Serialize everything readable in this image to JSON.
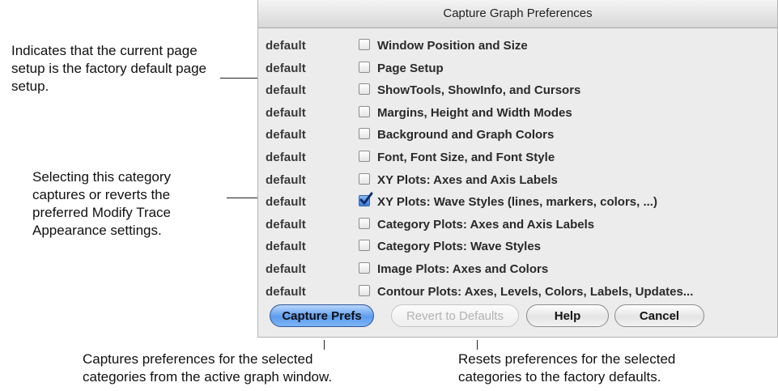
{
  "annotations": {
    "page_setup_note": "Indicates that the current page setup is the factory default page setup.",
    "wave_styles_note": "Selecting this category captures or reverts the preferred Modify Trace Appearance settings.",
    "capture_note": "Captures preferences for the selected categories from the active graph window.",
    "revert_note": "Resets preferences for the selected categories to the factory defaults."
  },
  "dialog": {
    "title": "Capture Graph Preferences",
    "rows": [
      {
        "status": "default",
        "label": "Window Position and Size",
        "checked": false
      },
      {
        "status": "default",
        "label": "Page Setup",
        "checked": false
      },
      {
        "status": "default",
        "label": "ShowTools, ShowInfo, and Cursors",
        "checked": false
      },
      {
        "status": "default",
        "label": "Margins, Height and Width Modes",
        "checked": false
      },
      {
        "status": "default",
        "label": "Background and Graph Colors",
        "checked": false
      },
      {
        "status": "default",
        "label": "Font, Font Size, and Font Style",
        "checked": false
      },
      {
        "status": "default",
        "label": "XY Plots: Axes and Axis Labels",
        "checked": false
      },
      {
        "status": "default",
        "label": "XY Plots: Wave Styles (lines, markers, colors, ...)",
        "checked": true
      },
      {
        "status": "default",
        "label": "Category Plots: Axes and Axis Labels",
        "checked": false
      },
      {
        "status": "default",
        "label": "Category Plots: Wave Styles",
        "checked": false
      },
      {
        "status": "default",
        "label": "Image Plots: Axes and Colors",
        "checked": false
      },
      {
        "status": "default",
        "label": "Contour Plots: Axes, Levels, Colors, Labels, Updates...",
        "checked": false
      }
    ],
    "buttons": {
      "capture": "Capture Prefs",
      "revert": "Revert to Defaults",
      "help": "Help",
      "cancel": "Cancel"
    },
    "colors": {
      "default_button": "#5d9cee",
      "checkbox_checked": "#3c7ed6",
      "dialog_bg": "#ececec"
    }
  }
}
